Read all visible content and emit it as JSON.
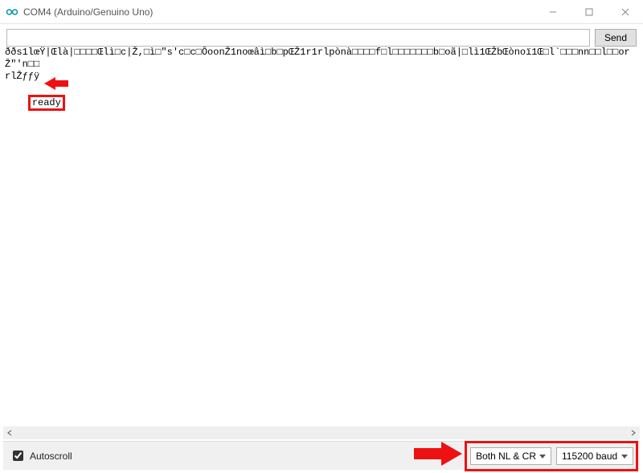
{
  "window": {
    "title": "COM4 (Arduino/Genuino Uno)"
  },
  "sendbar": {
    "input_value": "",
    "input_placeholder": "",
    "send_label": "Send"
  },
  "console": {
    "line1": "ððs1lœŸ|Œlà|□□□□Œlì□c|Ž,□ì□\"s'c□c□ÔoonŽ1noœâì□b□pŒŽ1r1rlpònà□□□□f□l□□□□□□□b□oã|□lì1ŒŽbŒònoï1Œ□l`□□□nn□□l□□orŽ\"'n□□",
    "line2": "rlŽƒƒÿ",
    "line3": "ready"
  },
  "status": {
    "autoscroll_label": "Autoscroll",
    "autoscroll_checked": true,
    "line_ending": "Both NL & CR",
    "baud_rate": "115200 baud"
  },
  "icons": {
    "app": "arduino-logo-icon",
    "minimize": "minimize-icon",
    "maximize": "maximize-icon",
    "close": "close-icon",
    "scroll_left": "chevron-left-icon",
    "scroll_right": "chevron-right-icon"
  },
  "colors": {
    "highlight": "#ee1111",
    "arduino_teal": "#00979d"
  }
}
